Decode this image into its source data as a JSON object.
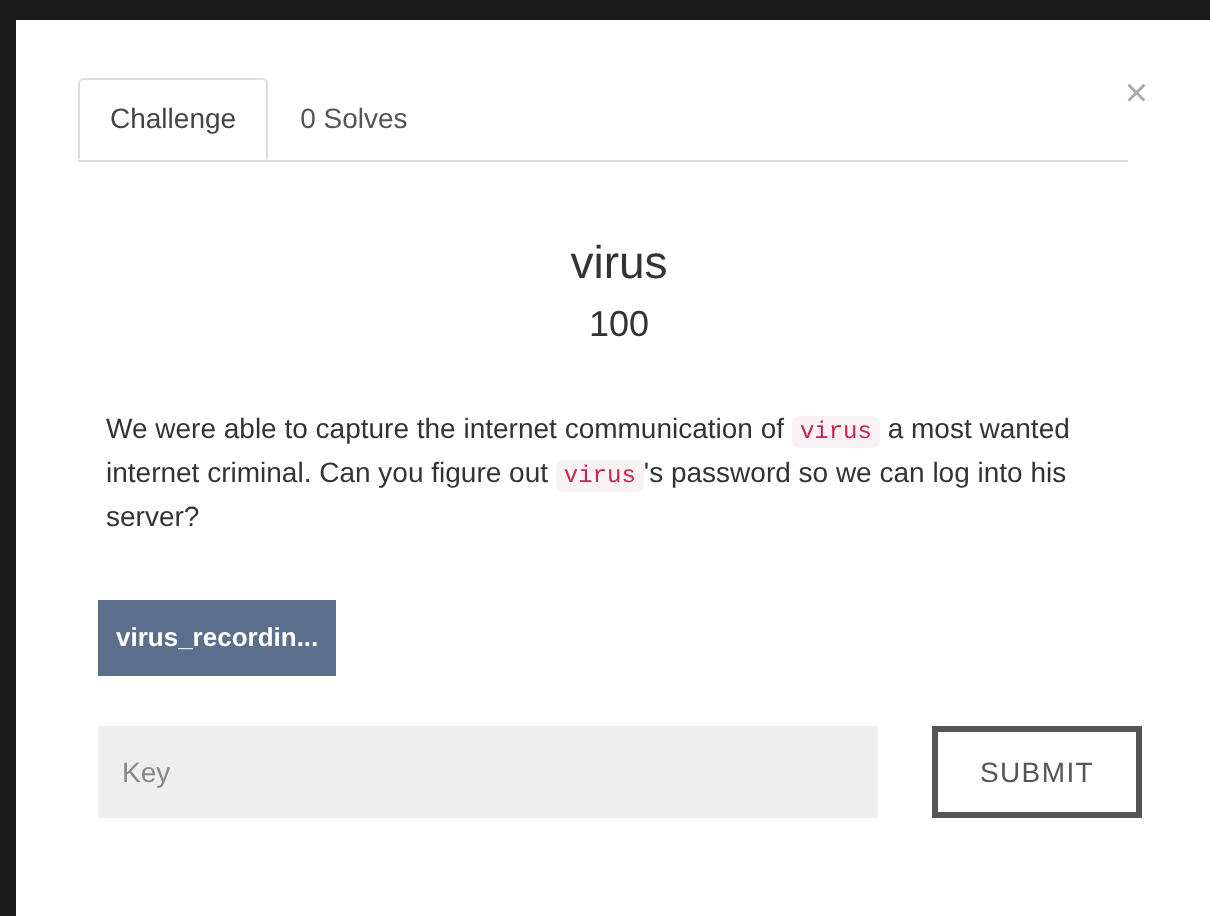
{
  "tabs": [
    {
      "label": "Challenge",
      "selected": true
    },
    {
      "label": "0 Solves",
      "selected": false
    }
  ],
  "close": "×",
  "challenge": {
    "name": "virus",
    "value": "100",
    "description": [
      {
        "kind": "text",
        "text": "We were able to capture the internet communication of "
      },
      {
        "kind": "code",
        "text": "virus"
      },
      {
        "kind": "text",
        "text": " a most wanted internet criminal. Can you figure out "
      },
      {
        "kind": "code",
        "text": "virus"
      },
      {
        "kind": "text",
        "text": "'s password so we can log into his server?"
      }
    ],
    "files": [
      "virus_recordin..."
    ]
  },
  "key_field": {
    "placeholder": "Key"
  },
  "submit": "SUBMIT"
}
